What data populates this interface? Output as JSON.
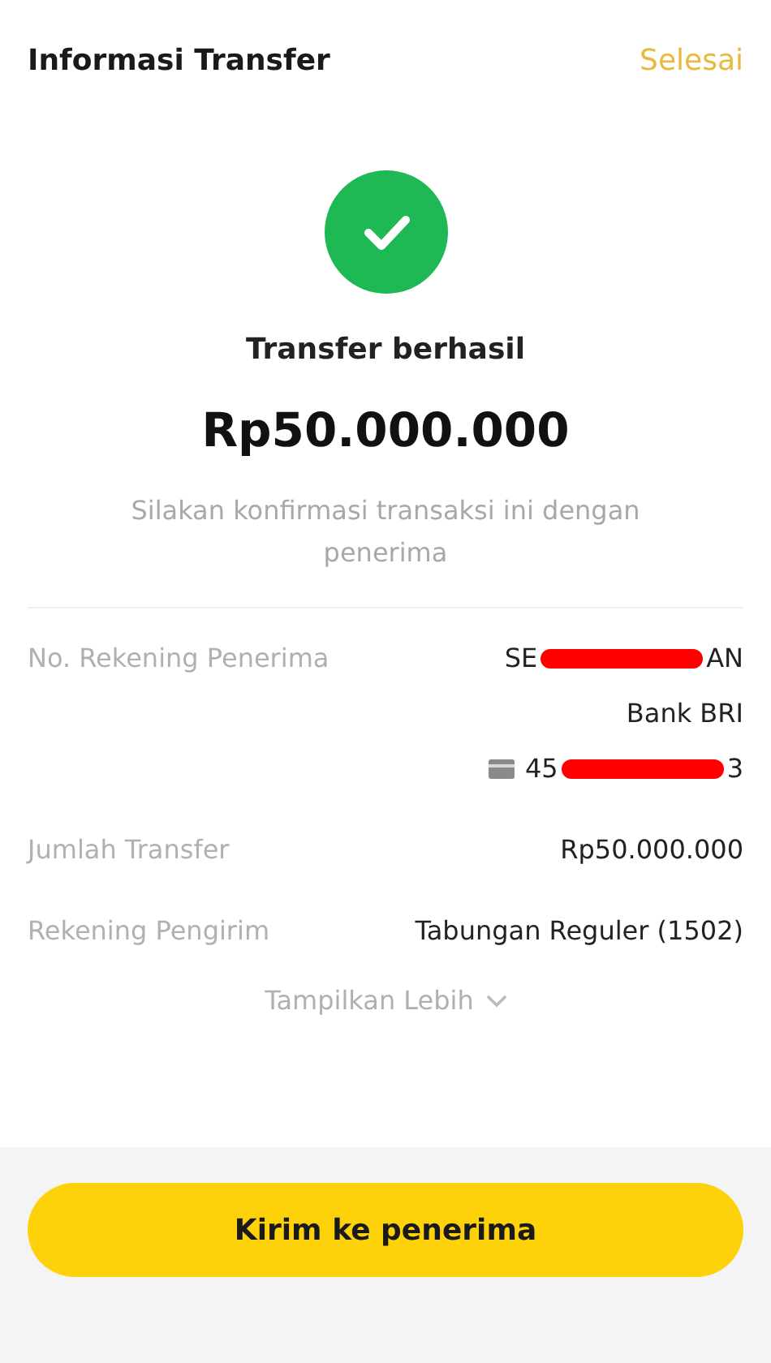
{
  "header": {
    "title": "Informasi Transfer",
    "action": "Selesai"
  },
  "result": {
    "status": "Transfer berhasil",
    "amount": "Rp50.000.000",
    "note": "Silakan konfirmasi transaksi ini dengan penerima"
  },
  "details": [
    {
      "label": "No. Rekening Penerima",
      "lines": [
        {
          "kind": "redacted",
          "start": "SE",
          "end": "AN"
        },
        {
          "kind": "text",
          "text": "Bank BRI"
        },
        {
          "kind": "account",
          "start": "45",
          "end": "3"
        }
      ]
    },
    {
      "label": "Jumlah Transfer",
      "lines": [
        {
          "kind": "text",
          "text": "Rp50.000.000"
        }
      ]
    },
    {
      "label": "Rekening Pengirim",
      "lines": [
        {
          "kind": "text",
          "text": "Tabungan Reguler (1502)"
        }
      ]
    }
  ],
  "more": {
    "label": "Tampilkan Lebih"
  },
  "button": {
    "label": "Kirim ke penerima"
  }
}
